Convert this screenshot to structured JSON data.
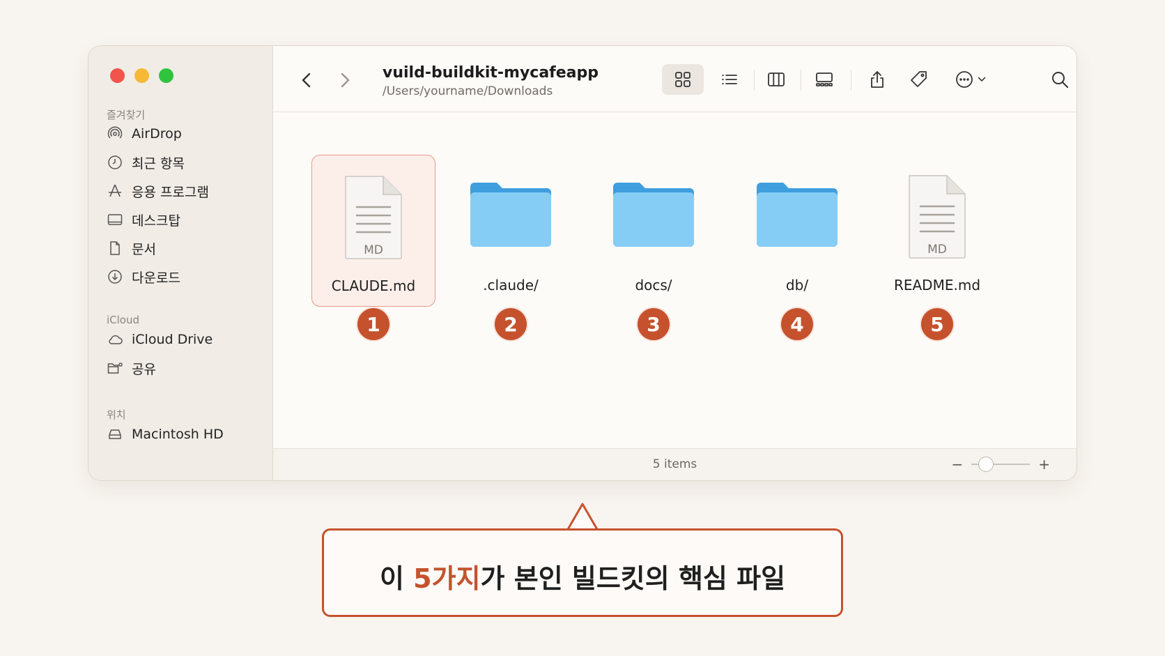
{
  "window": {
    "title": "vuild-buildkit-mycafeapp",
    "path": "/Users/yourname/Downloads"
  },
  "sidebar": {
    "favorites_header": "즐겨찾기",
    "favorites": [
      {
        "label": "AirDrop",
        "icon": "airdrop-icon"
      },
      {
        "label": "최근 항목",
        "icon": "clock-icon"
      },
      {
        "label": "응용 프로그램",
        "icon": "applications-icon"
      },
      {
        "label": "데스크탑",
        "icon": "desktop-icon"
      },
      {
        "label": "문서",
        "icon": "document-icon"
      },
      {
        "label": "다운로드",
        "icon": "download-icon"
      }
    ],
    "icloud_header": "iCloud",
    "icloud": [
      {
        "label": "iCloud Drive",
        "icon": "cloud-icon"
      },
      {
        "label": "공유",
        "icon": "shared-folder-icon"
      }
    ],
    "locations_header": "위치",
    "locations": [
      {
        "label": "Macintosh HD",
        "icon": "hard-drive-icon"
      }
    ]
  },
  "files": [
    {
      "name": "CLAUDE.md",
      "kind": "md",
      "tag": "MD",
      "badge": "1",
      "selected": true
    },
    {
      "name": ".claude/",
      "kind": "folder",
      "badge": "2"
    },
    {
      "name": "docs/",
      "kind": "folder",
      "badge": "3"
    },
    {
      "name": "db/",
      "kind": "folder",
      "badge": "4"
    },
    {
      "name": "README.md",
      "kind": "md",
      "tag": "MD",
      "badge": "5"
    }
  ],
  "status": {
    "items_text": "5 items",
    "zoom_minus": "−",
    "zoom_plus": "+",
    "zoom_level": 0.25
  },
  "callout": {
    "prefix": "이 ",
    "highlight": "5가지",
    "suffix": "가 본인 빌드킷의 핵심 파일"
  },
  "colors": {
    "accent": "#c5522d",
    "folder": "#7cc4f1",
    "traffic_red": "#f0544c",
    "traffic_yellow": "#f6b935",
    "traffic_green": "#2fc340"
  }
}
